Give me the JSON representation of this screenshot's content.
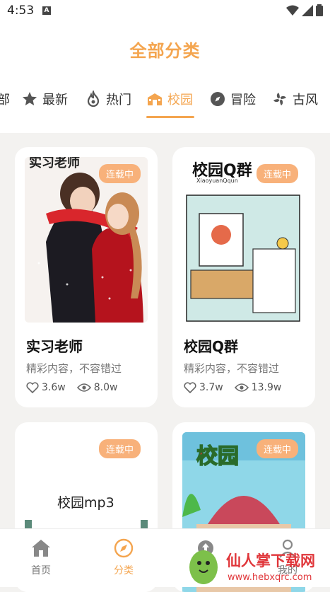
{
  "status": {
    "time": "4:53",
    "sim": "A"
  },
  "header": {
    "title": "全部分类"
  },
  "tabs": [
    {
      "label": "部",
      "icon": "partial-tab"
    },
    {
      "label": "最新",
      "icon": "star-icon"
    },
    {
      "label": "热门",
      "icon": "flame-icon"
    },
    {
      "label": "校园",
      "icon": "school-icon",
      "active": true
    },
    {
      "label": "冒险",
      "icon": "compass-icon"
    },
    {
      "label": "古风",
      "icon": "fan-icon"
    }
  ],
  "cards": [
    {
      "title": "实习老师",
      "desc": "精彩内容，不容错过",
      "badge": "连载中",
      "likes": "3.6w",
      "views": "8.0w",
      "cover_text": "实习老师"
    },
    {
      "title": "校园Q群",
      "desc": "精彩内容，不容错过",
      "badge": "连载中",
      "likes": "3.7w",
      "views": "13.9w",
      "cover_text": "校园Q群",
      "cover_sub": "XiaoyuanQqun"
    },
    {
      "title": "",
      "desc": "",
      "badge": "连载中",
      "cover_text": "校园mp3"
    },
    {
      "title": "",
      "desc": "",
      "badge": "连载中",
      "cover_text": "校园"
    }
  ],
  "bottom_nav": [
    {
      "label": "首页",
      "icon": "home-icon"
    },
    {
      "label": "分类",
      "icon": "compass-icon",
      "active": true
    },
    {
      "label": "",
      "icon": "upload-icon"
    },
    {
      "label": "我的",
      "icon": "profile-icon"
    }
  ],
  "watermark": {
    "text": "仙人掌下载网",
    "url": "www.hebxqrc.com"
  },
  "colors": {
    "accent": "#f4a54f",
    "badge": "#f8b17a",
    "background": "#f3f2f0"
  }
}
